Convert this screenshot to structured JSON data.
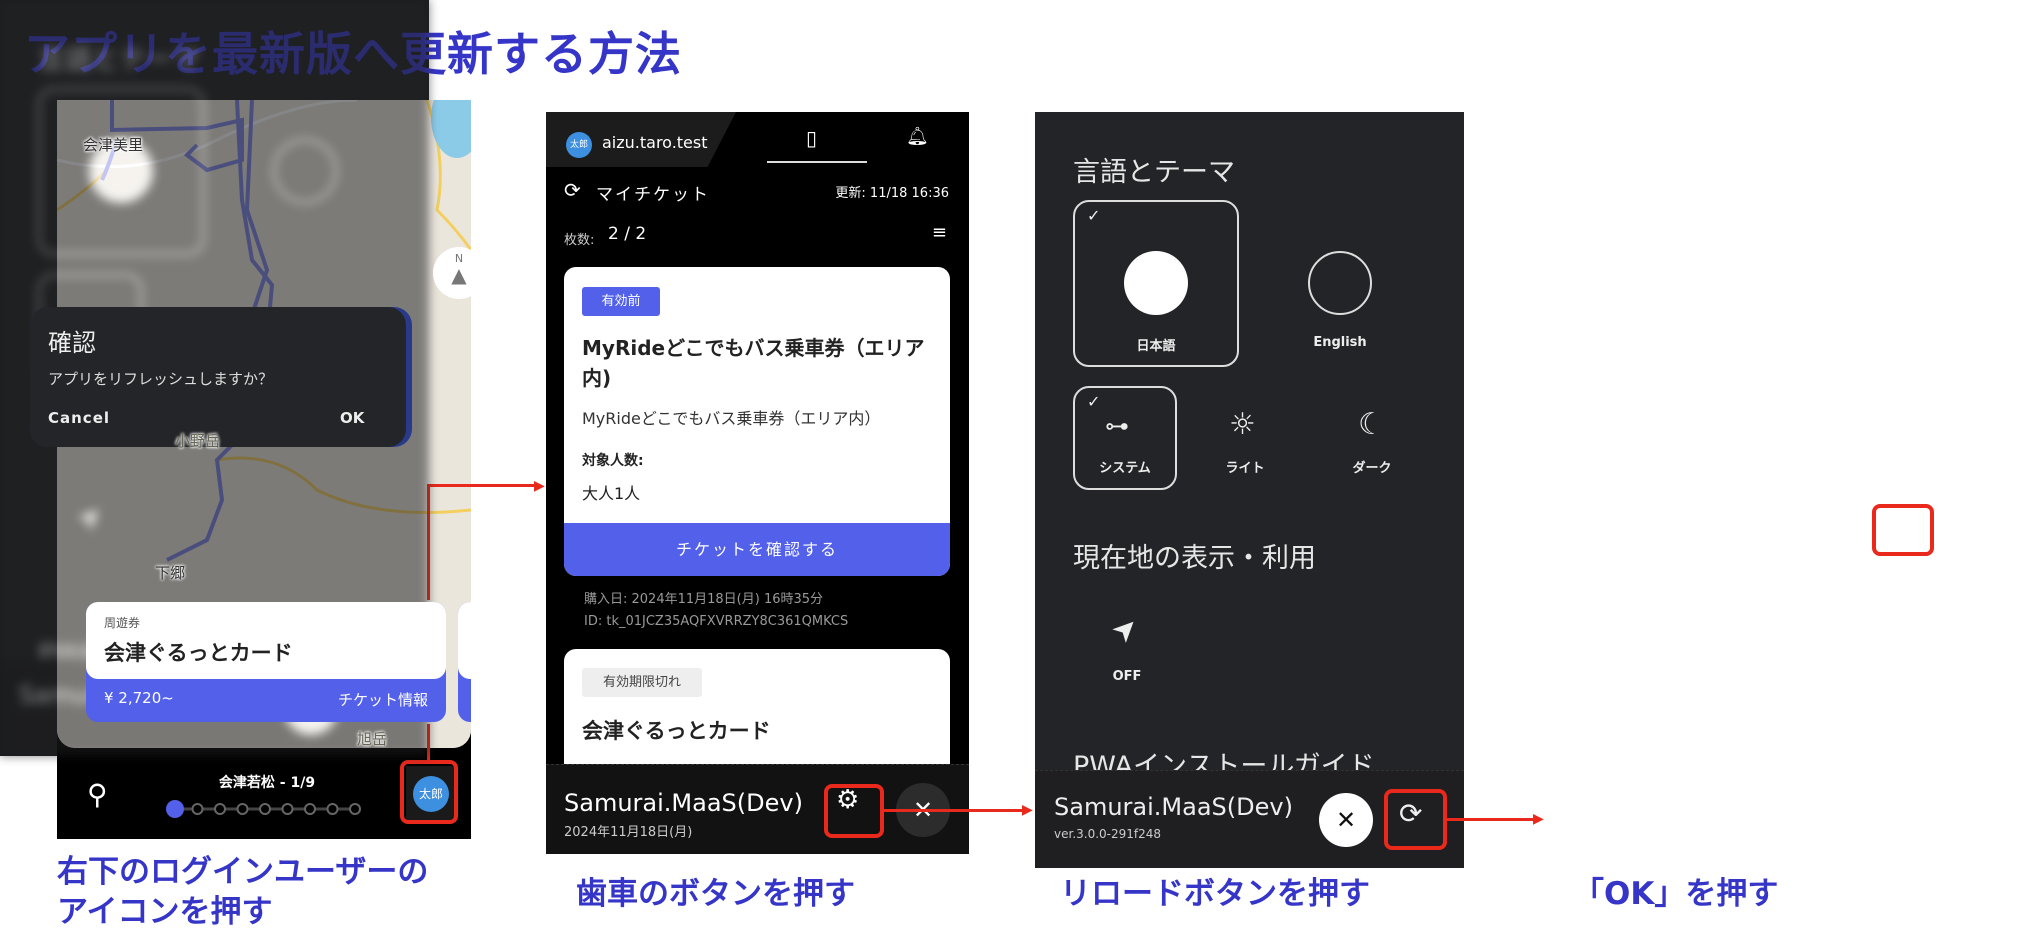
{
  "title": "アプリを最新版へ更新する方法",
  "captions": {
    "step1_line1": "右下のログインユーザーの",
    "step1_line2": "アイコンを押す",
    "step2": "歯車のボタンを押す",
    "step3": "リロードボタンを押す",
    "step4": "「OK」を押す"
  },
  "colors": {
    "accent": "#5260ea",
    "highlight": "#e8291c",
    "caption": "#3535c8"
  },
  "screen1": {
    "map_labels": [
      "会津美里",
      "小野岳",
      "下郷",
      "旭岳"
    ],
    "compass": "N",
    "ticket_card": {
      "category": "周遊券",
      "name": "会津ぐるっとカード",
      "price": "¥ 2,720~",
      "link": "チケット情報"
    },
    "station": "会津若松 - 1/9",
    "station_progress": {
      "current": 1,
      "total": 9
    },
    "avatar": "太郎",
    "icons": [
      "search-icon",
      "compass-icon",
      "avatar-icon"
    ]
  },
  "screen2": {
    "avatar": "太郎",
    "username": "aizu.taro.test",
    "section": "マイチケット",
    "updated": "更新: 11/18 16:36",
    "count_label": "枚数:",
    "count": "2 / 2",
    "tickets": [
      {
        "badge": "有効前",
        "title": "MyRideどこでもバス乗車券（エリア内)",
        "subtitle": "MyRideどこでもバス乗車券（エリア内）",
        "people_label": "対象人数:",
        "people": "大人1人",
        "button": "チケットを確認する",
        "purchase": "購入日: 2024年11月18日(月) 16時35分",
        "id": "ID: tk_01JCZ35AQFXVRRZY8C361QMKCS"
      },
      {
        "badge": "有効期限切れ",
        "title": "会津ぐるっとカード"
      }
    ],
    "footer": {
      "app": "Samurai.MaaS(Dev)",
      "date": "2024年11月18日(月)"
    }
  },
  "screen3": {
    "lang_theme": "言語とテーマ",
    "languages": [
      {
        "label": "日本語",
        "selected": true
      },
      {
        "label": "English",
        "selected": false
      }
    ],
    "themes": [
      {
        "label": "システム",
        "selected": true
      },
      {
        "label": "ライト",
        "selected": false
      },
      {
        "label": "ダーク",
        "selected": false
      }
    ],
    "location": "現在地の表示・利用",
    "location_value": "OFF",
    "pwa": "PWAインストールガイド",
    "footer": {
      "app": "Samurai.MaaS(Dev)",
      "version": "ver.3.0.0-291f248"
    }
  },
  "dialog": {
    "title": "確認",
    "message": "アプリをリフレッシュしますか？",
    "cancel": "Cancel",
    "ok": "OK"
  }
}
